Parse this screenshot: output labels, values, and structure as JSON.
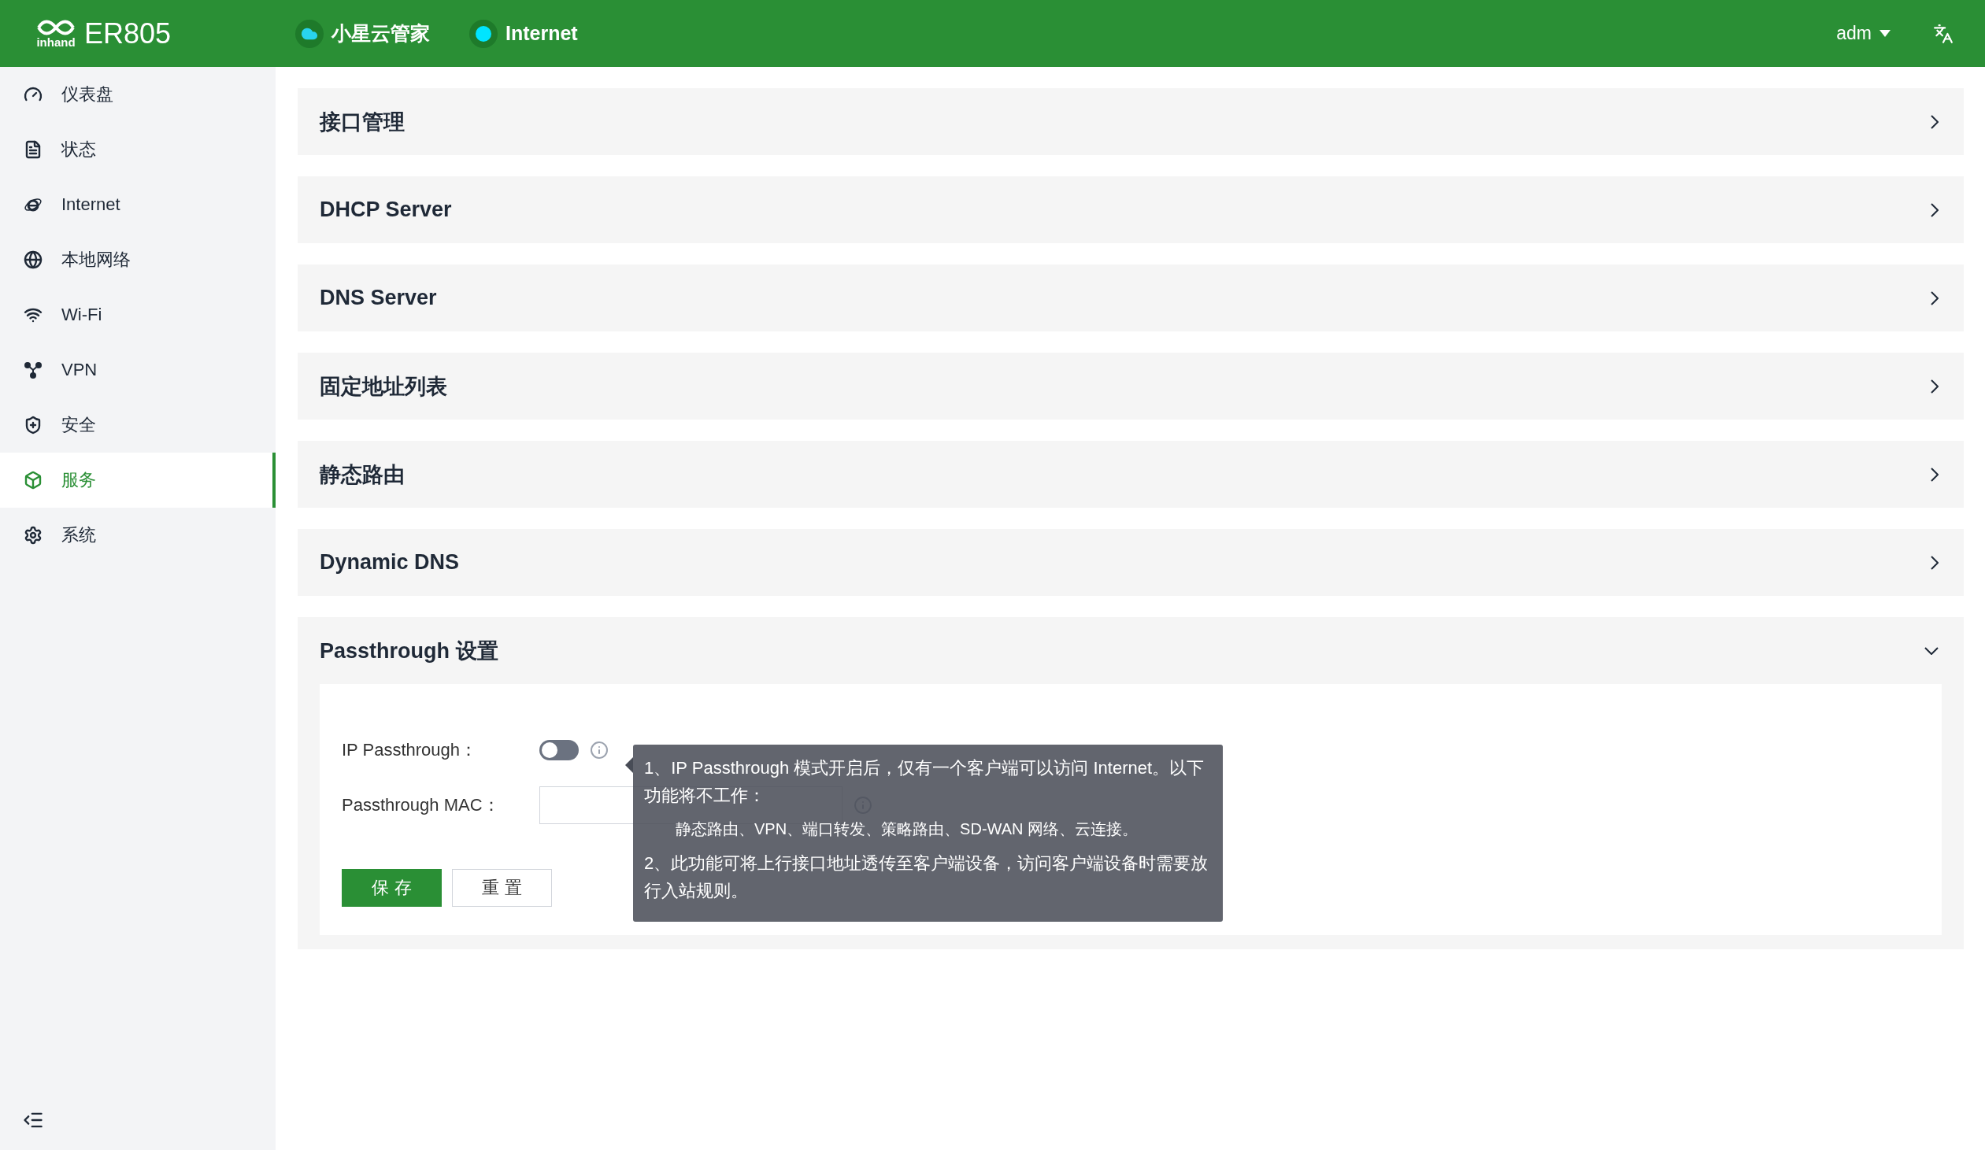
{
  "header": {
    "logo_text": "inhand",
    "model": "ER805",
    "status": [
      {
        "label": "小星云管家",
        "color": "#29d4ee"
      },
      {
        "label": "Internet",
        "color": "#00e5ff"
      }
    ],
    "user": "adm"
  },
  "sidebar": {
    "items": [
      {
        "label": "仪表盘",
        "selected": false
      },
      {
        "label": "状态",
        "selected": false
      },
      {
        "label": "Internet",
        "selected": false
      },
      {
        "label": "本地网络",
        "selected": false
      },
      {
        "label": "Wi-Fi",
        "selected": false
      },
      {
        "label": "VPN",
        "selected": false
      },
      {
        "label": "安全",
        "selected": false
      },
      {
        "label": "服务",
        "selected": true
      },
      {
        "label": "系统",
        "selected": false
      }
    ]
  },
  "panels": [
    {
      "title": "接口管理",
      "expanded": false
    },
    {
      "title": "DHCP Server",
      "expanded": false
    },
    {
      "title": "DNS Server",
      "expanded": false
    },
    {
      "title": "固定地址列表",
      "expanded": false
    },
    {
      "title": "静态路由",
      "expanded": false
    },
    {
      "title": "Dynamic DNS",
      "expanded": false
    },
    {
      "title": "Passthrough 设置",
      "expanded": true
    }
  ],
  "passthrough_form": {
    "ip_passthrough": {
      "label": "IP Passthrough：",
      "on": false
    },
    "passthrough_mac": {
      "label": "Passthrough MAC："
    },
    "buttons": [
      {
        "label": "保 存",
        "kind": "primary"
      },
      {
        "label": "重 置",
        "kind": "default"
      }
    ]
  },
  "tooltip": {
    "lines": [
      "1、IP Passthrough 模式开启后，仅有一个客户端可以访问 Internet。以下功能将不工作：",
      "静态路由、VPN、端口转发、策略路由、SD-WAN 网络、云连接。",
      "2、此功能可将上行接口地址透传至客户端设备，访问客户端设备时需要放行入站规则。"
    ]
  }
}
